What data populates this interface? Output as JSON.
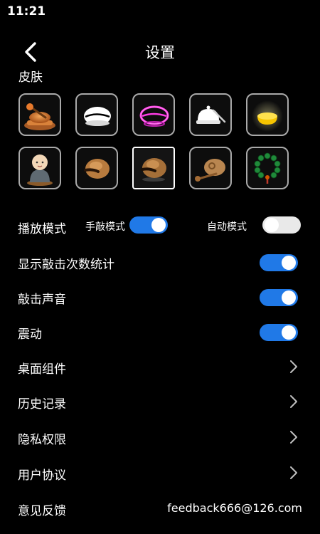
{
  "status": {
    "time": "11:21"
  },
  "header": {
    "title": "设置",
    "back_icon": "chevron-left-icon"
  },
  "skin_section": {
    "label": "皮肤",
    "skins": [
      {
        "name": "gong-with-mallet",
        "selected": false
      },
      {
        "name": "white-wooden-fish",
        "selected": false
      },
      {
        "name": "neon-pink-wooden-fish",
        "selected": false
      },
      {
        "name": "bell-with-striker",
        "selected": false
      },
      {
        "name": "golden-glowing-bowl",
        "selected": false
      },
      {
        "name": "little-monk",
        "selected": false
      },
      {
        "name": "brown-wooden-fish",
        "selected": false
      },
      {
        "name": "dark-wooden-fish",
        "selected": true
      },
      {
        "name": "carved-wooden-fish-with-stick",
        "selected": false
      },
      {
        "name": "green-prayer-beads",
        "selected": false
      }
    ]
  },
  "play_mode": {
    "label": "播放模式",
    "manual_label": "手敲模式",
    "manual_on": true,
    "auto_label": "自动模式",
    "auto_on": false
  },
  "settings": {
    "show_stats": {
      "label": "显示敲击次数统计",
      "on": true
    },
    "sound": {
      "label": "敲击声音",
      "on": true
    },
    "vibration": {
      "label": "震动",
      "on": true
    },
    "widget": {
      "label": "桌面组件"
    },
    "history": {
      "label": "历史记录"
    },
    "privacy": {
      "label": "隐私权限"
    },
    "agreement": {
      "label": "用户协议"
    },
    "feedback": {
      "label": "意见反馈",
      "email": "feedback666@126.com"
    }
  },
  "colors": {
    "toggle_on": "#2079e7",
    "toggle_off": "#e9e9e9",
    "background": "#000000"
  }
}
